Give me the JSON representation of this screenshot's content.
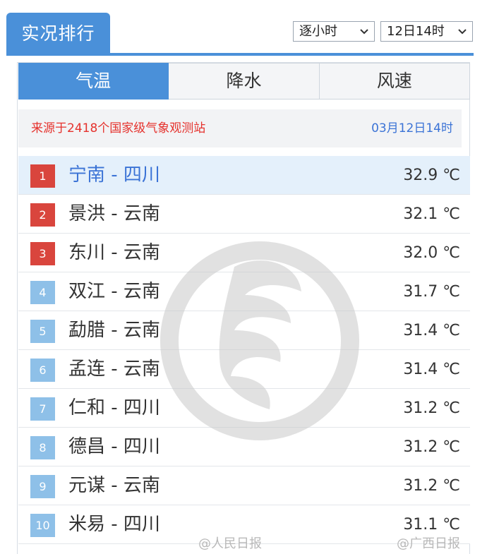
{
  "header": {
    "title": "实况排行",
    "mode_select": "逐小时",
    "time_select": "12日14时"
  },
  "tabs": [
    {
      "label": "气温",
      "active": true
    },
    {
      "label": "降水",
      "active": false
    },
    {
      "label": "风速",
      "active": false
    }
  ],
  "source": {
    "text": "来源于2418个国家级气象观测站",
    "time": "03月12日14时"
  },
  "rows": [
    {
      "rank": "1",
      "place": "宁南 - 四川",
      "temp": "32.9 ℃"
    },
    {
      "rank": "2",
      "place": "景洪 - 云南",
      "temp": "32.1 ℃"
    },
    {
      "rank": "3",
      "place": "东川 - 云南",
      "temp": "32.0 ℃"
    },
    {
      "rank": "4",
      "place": "双江 - 云南",
      "temp": "31.7 ℃"
    },
    {
      "rank": "5",
      "place": "勐腊 - 云南",
      "temp": "31.4 ℃"
    },
    {
      "rank": "6",
      "place": "孟连 - 云南",
      "temp": "31.4 ℃"
    },
    {
      "rank": "7",
      "place": "仁和 - 四川",
      "temp": "31.2 ℃"
    },
    {
      "rank": "8",
      "place": "德昌 - 四川",
      "temp": "31.2 ℃"
    },
    {
      "rank": "9",
      "place": "元谋 - 云南",
      "temp": "31.2 ℃"
    },
    {
      "rank": "10",
      "place": "米易 - 四川",
      "temp": "31.1 ℃"
    }
  ],
  "credits": [
    "@人民日报",
    "@广西日报"
  ],
  "colors": {
    "accent": "#4a90d9",
    "hot_rank": "#d9453d",
    "cool_rank": "#8ec0e8",
    "source_red": "#e5322d",
    "time_blue": "#3b73d6"
  },
  "icons": {
    "dropdown": "chevron-down-icon",
    "watermark": "dragon-logo-icon"
  }
}
